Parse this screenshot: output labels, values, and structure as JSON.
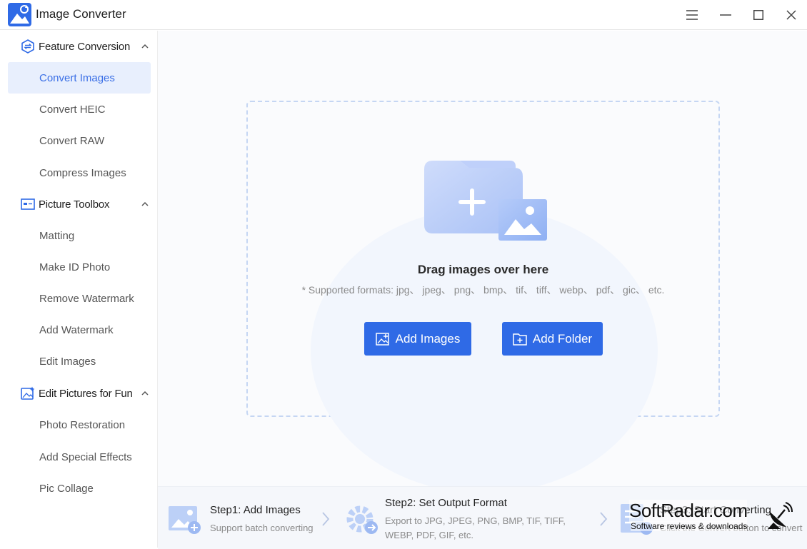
{
  "app": {
    "title": "Image Converter"
  },
  "window_controls": [
    "menu-icon",
    "minimize-icon",
    "maximize-icon",
    "close-icon"
  ],
  "colors": {
    "accent": "#2f6ae6",
    "active_bg": "#e8effd",
    "active_text": "#3a6fe6",
    "dashed_border": "#c5d6f3"
  },
  "sidebar": {
    "sections": [
      {
        "label": "Feature Conversion",
        "icon": "conversion-icon",
        "items": [
          "Convert Images",
          "Convert HEIC",
          "Convert RAW",
          "Compress Images"
        ]
      },
      {
        "label": "Picture Toolbox",
        "icon": "toolbox-icon",
        "items": [
          "Matting",
          "Make ID Photo",
          "Remove Watermark",
          "Add Watermark",
          "Edit Images"
        ]
      },
      {
        "label": "Edit Pictures for Fun",
        "icon": "sparkle-image-icon",
        "items": [
          "Photo Restoration",
          "Add Special Effects",
          "Pic Collage"
        ]
      }
    ],
    "active_item": "Convert Images"
  },
  "dropzone": {
    "title": "Drag images over here",
    "formats": "* Supported formats: jpg、 jpeg、 png、 bmp、 tif、 tiff、 webp、 pdf、 gic、 etc.",
    "add_images": "Add Images",
    "add_folder": "Add Folder"
  },
  "steps": [
    {
      "title": "Step1:  Add Images",
      "desc_lines": [
        "Support batch converting"
      ]
    },
    {
      "title": "Step2:  Set Output Format",
      "desc_lines": [
        "Export to JPG, JPEG, PNG, BMP, TIF, TIFF,",
        "WEBP, PDF, GIF, etc."
      ]
    },
    {
      "title": "Step3:  Start Converting",
      "desc_lines": [
        "Click the Convert button to convert"
      ]
    }
  ],
  "watermark": {
    "main": "SoftRadar.com",
    "sub": "Software reviews & downloads"
  }
}
